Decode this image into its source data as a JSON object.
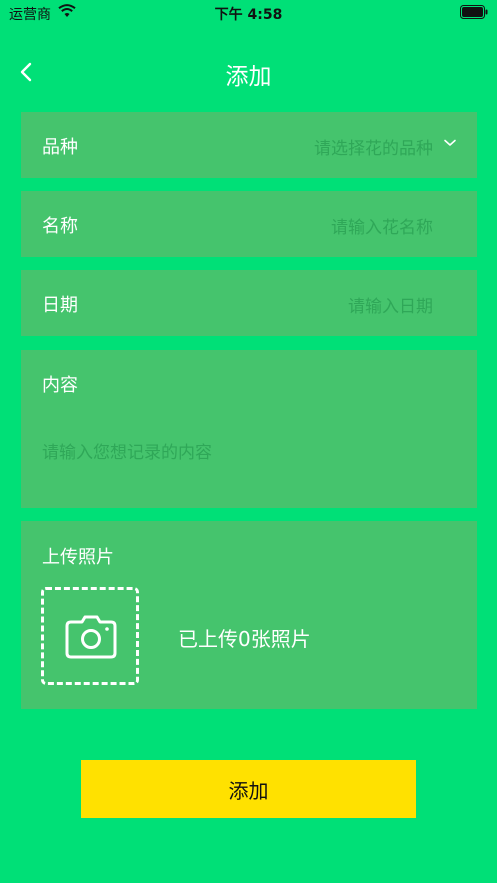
{
  "status_bar": {
    "carrier": "运营商",
    "time": "下午 4:58"
  },
  "nav": {
    "title": "添加"
  },
  "form": {
    "variety": {
      "label": "品种",
      "placeholder": "请选择花的品种"
    },
    "name": {
      "label": "名称",
      "placeholder": "请输入花名称"
    },
    "date": {
      "label": "日期",
      "placeholder": "请输入日期"
    },
    "content": {
      "label": "内容",
      "placeholder": "请输入您想记录的内容"
    },
    "upload": {
      "label": "上传照片",
      "count_text": "已上传0张照片"
    }
  },
  "submit": {
    "label": "添加"
  },
  "colors": {
    "background": "#00E077",
    "card": "#45C46D",
    "button": "#FFE100"
  }
}
